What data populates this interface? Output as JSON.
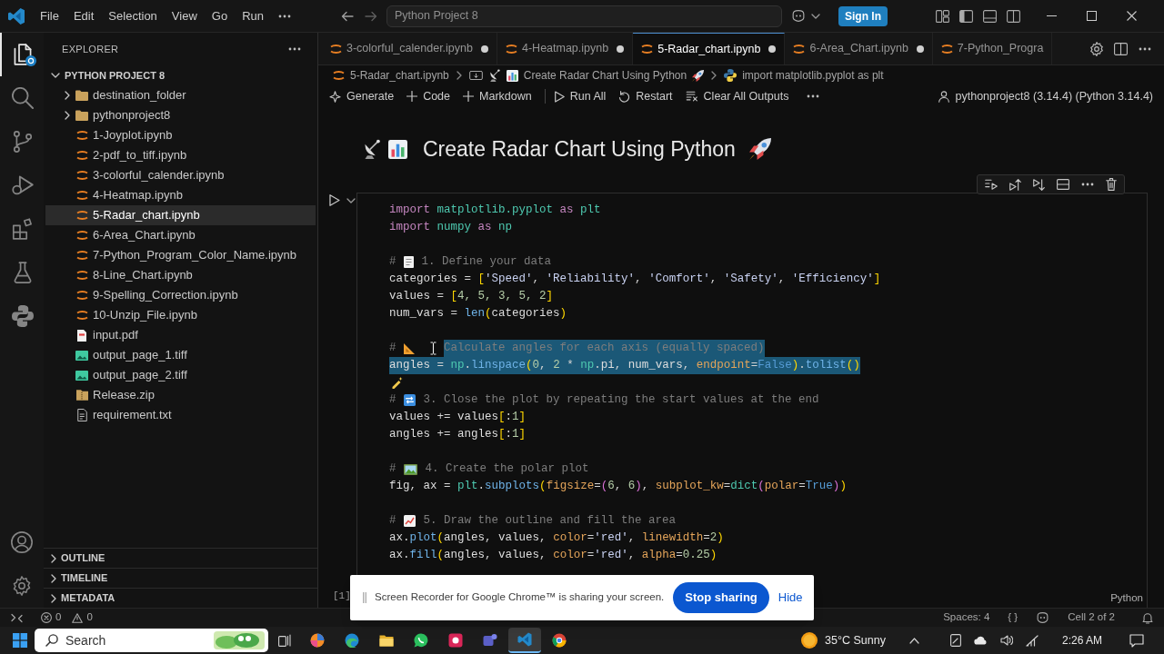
{
  "title_bar": {
    "menus": [
      "File",
      "Edit",
      "Selection",
      "View",
      "Go",
      "Run"
    ],
    "command_center": "Python Project 8",
    "sign_in_button": "Sign In"
  },
  "activity_bar": {
    "items": [
      {
        "selected": true
      },
      {
        "selected": false
      },
      {
        "selected": false
      },
      {
        "selected": false
      },
      {
        "selected": false
      },
      {
        "selected": false
      },
      {
        "selected": false
      }
    ]
  },
  "sidebar": {
    "title": "EXPLORER",
    "root": {
      "label": "PYTHON PROJECT 8",
      "expanded": true,
      "children": [
        {
          "label": "destination_folder",
          "kind": "folder",
          "expanded": false,
          "selected": false
        },
        {
          "label": "pythonproject8",
          "kind": "folder",
          "expanded": false,
          "selected": false
        },
        {
          "label": "1-Joyplot.ipynb",
          "kind": "notebook",
          "selected": false
        },
        {
          "label": "2-pdf_to_tiff.ipynb",
          "kind": "notebook",
          "selected": false
        },
        {
          "label": "3-colorful_calender.ipynb",
          "kind": "notebook",
          "selected": false
        },
        {
          "label": "4-Heatmap.ipynb",
          "kind": "notebook",
          "selected": false
        },
        {
          "label": "5-Radar_chart.ipynb",
          "kind": "notebook",
          "selected": true
        },
        {
          "label": "6-Area_Chart.ipynb",
          "kind": "notebook",
          "selected": false
        },
        {
          "label": "7-Python_Program_Color_Name.ipynb",
          "kind": "notebook",
          "selected": false
        },
        {
          "label": "8-Line_Chart.ipynb",
          "kind": "notebook",
          "selected": false
        },
        {
          "label": "9-Spelling_Correction.ipynb",
          "kind": "notebook",
          "selected": false
        },
        {
          "label": "10-Unzip_File.ipynb",
          "kind": "notebook",
          "selected": false
        },
        {
          "label": "input.pdf",
          "kind": "pdf",
          "selected": false
        },
        {
          "label": "output_page_1.tiff",
          "kind": "image",
          "selected": false
        },
        {
          "label": "output_page_2.tiff",
          "kind": "image",
          "selected": false
        },
        {
          "label": "Release.zip",
          "kind": "zip",
          "selected": false
        },
        {
          "label": "requirement.txt",
          "kind": "text",
          "selected": false
        }
      ]
    },
    "sections": [
      {
        "label": "OUTLINE",
        "expanded": false
      },
      {
        "label": "TIMELINE",
        "expanded": false
      },
      {
        "label": "METADATA",
        "expanded": false
      }
    ]
  },
  "tabs": [
    {
      "label": "3-colorful_calender.ipynb",
      "selected": false,
      "modified": true
    },
    {
      "label": "4-Heatmap.ipynb",
      "selected": false,
      "modified": true
    },
    {
      "label": "5-Radar_chart.ipynb",
      "selected": true,
      "modified": true
    },
    {
      "label": "6-Area_Chart.ipynb",
      "selected": false,
      "modified": true
    },
    {
      "label": "7-Python_Progra",
      "selected": false,
      "modified": false
    }
  ],
  "breadcrumbs": [
    {
      "kind": "notebook",
      "text": "5-Radar_chart.ipynb"
    },
    {
      "kind": "markdown",
      "text": "Create Radar Chart Using Python"
    },
    {
      "kind": "python",
      "text": "import matplotlib.pyplot as plt"
    }
  ],
  "notebook_toolbar": {
    "actions": [
      {
        "kind": "generate",
        "label": "Generate"
      },
      {
        "kind": "add",
        "label": "Code"
      },
      {
        "kind": "add",
        "label": "Markdown"
      },
      {
        "kind": "run",
        "label": "Run All"
      },
      {
        "kind": "restart",
        "label": "Restart"
      },
      {
        "kind": "clear",
        "label": "Clear All Outputs"
      }
    ],
    "kernel": "pythonproject8 (3.14.4) (Python 3.14.4)"
  },
  "markdown_cell": {
    "heading": "Create Radar Chart Using Python"
  },
  "code_cell": {
    "lines": [
      {
        "kind": "code",
        "tokens": [
          {
            "kind": "kw",
            "text": "import "
          },
          {
            "kind": "mod",
            "text": "matplotlib.pyplot "
          },
          {
            "kind": "kw",
            "text": "as "
          },
          {
            "kind": "mod",
            "text": "plt"
          }
        ]
      },
      {
        "kind": "code",
        "tokens": [
          {
            "kind": "kw",
            "text": "import "
          },
          {
            "kind": "mod",
            "text": "numpy "
          },
          {
            "kind": "kw",
            "text": "as "
          },
          {
            "kind": "mod",
            "text": "np"
          }
        ]
      },
      {
        "kind": "blank"
      },
      {
        "kind": "code",
        "tokens": [
          {
            "kind": "comment",
            "text": "# "
          },
          {
            "kind": "emoji"
          },
          {
            "kind": "comment",
            "text": " 1. Define your data"
          }
        ]
      },
      {
        "kind": "code",
        "tokens": [
          {
            "kind": "var",
            "text": "categories "
          },
          {
            "kind": "op",
            "text": "= "
          },
          {
            "kind": "b1",
            "text": "["
          },
          {
            "kind": "str",
            "text": "'Speed'"
          },
          {
            "kind": "op",
            "text": ", "
          },
          {
            "kind": "str",
            "text": "'Reliability'"
          },
          {
            "kind": "op",
            "text": ", "
          },
          {
            "kind": "str",
            "text": "'Comfort'"
          },
          {
            "kind": "op",
            "text": ", "
          },
          {
            "kind": "str",
            "text": "'Safety'"
          },
          {
            "kind": "op",
            "text": ", "
          },
          {
            "kind": "str",
            "text": "'Efficiency'"
          },
          {
            "kind": "b1",
            "text": "]"
          }
        ]
      },
      {
        "kind": "code",
        "tokens": [
          {
            "kind": "var",
            "text": "values "
          },
          {
            "kind": "op",
            "text": "= "
          },
          {
            "kind": "b1",
            "text": "["
          },
          {
            "kind": "num",
            "text": "4, 5, 3, 5, 2"
          },
          {
            "kind": "b1",
            "text": "]"
          }
        ]
      },
      {
        "kind": "code",
        "tokens": [
          {
            "kind": "var",
            "text": "num_vars "
          },
          {
            "kind": "op",
            "text": "= "
          },
          {
            "kind": "fn",
            "text": "len"
          },
          {
            "kind": "b1",
            "text": "("
          },
          {
            "kind": "var",
            "text": "categories"
          },
          {
            "kind": "b1",
            "text": ")"
          }
        ]
      },
      {
        "kind": "blank"
      },
      {
        "kind": "code",
        "tokens": [
          {
            "kind": "comment",
            "text": "# "
          },
          {
            "kind": "emoji"
          },
          {
            "kind": "pointer"
          }
        ],
        "selected_tokens": [
          {
            "kind": "comment",
            "text": "Calculate angles for each axis (equally spaced)"
          }
        ]
      },
      {
        "kind": "code",
        "selected_tokens": [
          {
            "kind": "var",
            "text": "angles "
          },
          {
            "kind": "op",
            "text": "= "
          },
          {
            "kind": "mod",
            "text": "np"
          },
          {
            "kind": "op",
            "text": "."
          },
          {
            "kind": "fn",
            "text": "linspace"
          },
          {
            "kind": "b1",
            "text": "("
          },
          {
            "kind": "num",
            "text": "0"
          },
          {
            "kind": "op",
            "text": ", "
          },
          {
            "kind": "num",
            "text": "2"
          },
          {
            "kind": "op",
            "text": " * "
          },
          {
            "kind": "mod",
            "text": "np"
          },
          {
            "kind": "op",
            "text": "."
          },
          {
            "kind": "var",
            "text": "pi"
          },
          {
            "kind": "op",
            "text": ", "
          },
          {
            "kind": "var",
            "text": "num_vars"
          },
          {
            "kind": "op",
            "text": ", "
          },
          {
            "kind": "param",
            "text": "endpoint"
          },
          {
            "kind": "op",
            "text": "="
          },
          {
            "kind": "const",
            "text": "False"
          },
          {
            "kind": "b1",
            "text": ")"
          },
          {
            "kind": "op",
            "text": "."
          },
          {
            "kind": "fn",
            "text": "tolist"
          },
          {
            "kind": "b1",
            "text": "()"
          }
        ]
      },
      {
        "kind": "hint"
      },
      {
        "kind": "code",
        "tokens": [
          {
            "kind": "comment",
            "text": "# "
          },
          {
            "kind": "emoji"
          },
          {
            "kind": "comment",
            "text": " 3. Close the plot by repeating the start values at the end"
          }
        ]
      },
      {
        "kind": "code",
        "tokens": [
          {
            "kind": "var",
            "text": "values "
          },
          {
            "kind": "op",
            "text": "+= "
          },
          {
            "kind": "var",
            "text": "values"
          },
          {
            "kind": "b1",
            "text": "["
          },
          {
            "kind": "op",
            "text": ":"
          },
          {
            "kind": "num",
            "text": "1"
          },
          {
            "kind": "b1",
            "text": "]"
          }
        ]
      },
      {
        "kind": "code",
        "tokens": [
          {
            "kind": "var",
            "text": "angles "
          },
          {
            "kind": "op",
            "text": "+= "
          },
          {
            "kind": "var",
            "text": "angles"
          },
          {
            "kind": "b1",
            "text": "["
          },
          {
            "kind": "op",
            "text": ":"
          },
          {
            "kind": "num",
            "text": "1"
          },
          {
            "kind": "b1",
            "text": "]"
          }
        ]
      },
      {
        "kind": "blank"
      },
      {
        "kind": "code",
        "tokens": [
          {
            "kind": "comment",
            "text": "# "
          },
          {
            "kind": "emoji"
          },
          {
            "kind": "comment",
            "text": " 4. Create the polar plot"
          }
        ]
      },
      {
        "kind": "code",
        "tokens": [
          {
            "kind": "var",
            "text": "fig"
          },
          {
            "kind": "op",
            "text": ", "
          },
          {
            "kind": "var",
            "text": "ax "
          },
          {
            "kind": "op",
            "text": "= "
          },
          {
            "kind": "mod",
            "text": "plt"
          },
          {
            "kind": "op",
            "text": "."
          },
          {
            "kind": "fn",
            "text": "subplots"
          },
          {
            "kind": "b1",
            "text": "("
          },
          {
            "kind": "param",
            "text": "figsize"
          },
          {
            "kind": "op",
            "text": "="
          },
          {
            "kind": "b2",
            "text": "("
          },
          {
            "kind": "num",
            "text": "6"
          },
          {
            "kind": "op",
            "text": ", "
          },
          {
            "kind": "num",
            "text": "6"
          },
          {
            "kind": "b2",
            "text": ")"
          },
          {
            "kind": "op",
            "text": ", "
          },
          {
            "kind": "param",
            "text": "subplot_kw"
          },
          {
            "kind": "op",
            "text": "="
          },
          {
            "kind": "mod",
            "text": "dict"
          },
          {
            "kind": "b2",
            "text": "("
          },
          {
            "kind": "param",
            "text": "polar"
          },
          {
            "kind": "op",
            "text": "="
          },
          {
            "kind": "const",
            "text": "True"
          },
          {
            "kind": "b2",
            "text": ")"
          },
          {
            "kind": "b1",
            "text": ")"
          }
        ]
      },
      {
        "kind": "blank"
      },
      {
        "kind": "code",
        "tokens": [
          {
            "kind": "comment",
            "text": "# "
          },
          {
            "kind": "emoji"
          },
          {
            "kind": "comment",
            "text": " 5. Draw the outline and fill the area"
          }
        ]
      },
      {
        "kind": "code",
        "tokens": [
          {
            "kind": "var",
            "text": "ax"
          },
          {
            "kind": "op",
            "text": "."
          },
          {
            "kind": "fn",
            "text": "plot"
          },
          {
            "kind": "b1",
            "text": "("
          },
          {
            "kind": "var",
            "text": "angles"
          },
          {
            "kind": "op",
            "text": ", "
          },
          {
            "kind": "var",
            "text": "values"
          },
          {
            "kind": "op",
            "text": ", "
          },
          {
            "kind": "param",
            "text": "color"
          },
          {
            "kind": "op",
            "text": "="
          },
          {
            "kind": "str",
            "text": "'red'"
          },
          {
            "kind": "op",
            "text": ", "
          },
          {
            "kind": "param",
            "text": "linewidth"
          },
          {
            "kind": "op",
            "text": "="
          },
          {
            "kind": "num",
            "text": "2"
          },
          {
            "kind": "b1",
            "text": ")"
          }
        ]
      },
      {
        "kind": "code",
        "tokens": [
          {
            "kind": "var",
            "text": "ax"
          },
          {
            "kind": "op",
            "text": "."
          },
          {
            "kind": "fn",
            "text": "fill"
          },
          {
            "kind": "b1",
            "text": "("
          },
          {
            "kind": "var",
            "text": "angles"
          },
          {
            "kind": "op",
            "text": ", "
          },
          {
            "kind": "var",
            "text": "values"
          },
          {
            "kind": "op",
            "text": ", "
          },
          {
            "kind": "param",
            "text": "color"
          },
          {
            "kind": "op",
            "text": "="
          },
          {
            "kind": "str",
            "text": "'red'"
          },
          {
            "kind": "op",
            "text": ", "
          },
          {
            "kind": "param",
            "text": "alpha"
          },
          {
            "kind": "op",
            "text": "="
          },
          {
            "kind": "num",
            "text": "0.25"
          },
          {
            "kind": "b1",
            "text": ")"
          }
        ]
      }
    ],
    "execution_count": "[1]",
    "language": "Python"
  },
  "status_bar": {
    "errors": "0",
    "warnings": "0",
    "items": [
      "Spaces: 4",
      "{ }"
    ],
    "cell_position": "Cell 2 of 2"
  },
  "share_banner": {
    "message": "Screen Recorder for Google Chrome™ is sharing your screen.",
    "stop_button": "Stop sharing",
    "hide_link": "Hide"
  },
  "taskbar": {
    "search": {
      "placeholder": "Search"
    },
    "apps": [
      {
        "active": false
      },
      {
        "active": false
      },
      {
        "active": false
      },
      {
        "active": false
      },
      {
        "active": false
      },
      {
        "active": false
      },
      {
        "active": true
      },
      {
        "active": false
      }
    ],
    "weather": "35°C Sunny",
    "time": "2:26 AM"
  }
}
